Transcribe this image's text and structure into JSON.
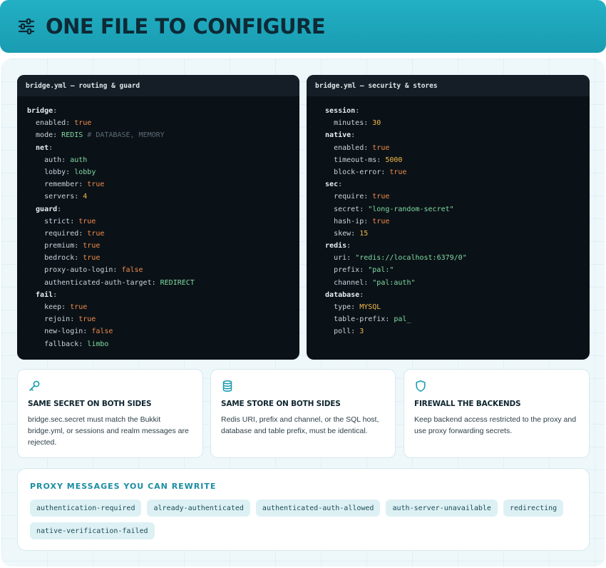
{
  "header": {
    "title": "ONE FILE TO CONFIGURE"
  },
  "code_left": {
    "title": "bridge.yml — routing & guard",
    "lines": [
      [
        {
          "t": "bridge",
          "c": "kb"
        },
        {
          "t": ":",
          "c": "k"
        }
      ],
      [
        {
          "t": "  enabled: ",
          "c": "k"
        },
        {
          "t": "true",
          "c": "bool"
        }
      ],
      [
        {
          "t": "  mode: ",
          "c": "k"
        },
        {
          "t": "REDIS",
          "c": "str"
        },
        {
          "t": " # DATABASE, MEMORY",
          "c": "cm"
        }
      ],
      [
        {
          "t": "  net",
          "c": "kb"
        },
        {
          "t": ":",
          "c": "k"
        }
      ],
      [
        {
          "t": "    auth: ",
          "c": "k"
        },
        {
          "t": "auth",
          "c": "str"
        }
      ],
      [
        {
          "t": "    lobby: ",
          "c": "k"
        },
        {
          "t": "lobby",
          "c": "str"
        }
      ],
      [
        {
          "t": "    remember: ",
          "c": "k"
        },
        {
          "t": "true",
          "c": "bool"
        }
      ],
      [
        {
          "t": "    servers: ",
          "c": "k"
        },
        {
          "t": "4",
          "c": "num"
        }
      ],
      [
        {
          "t": "  guard",
          "c": "kb"
        },
        {
          "t": ":",
          "c": "k"
        }
      ],
      [
        {
          "t": "    strict: ",
          "c": "k"
        },
        {
          "t": "true",
          "c": "bool"
        }
      ],
      [
        {
          "t": "    required: ",
          "c": "k"
        },
        {
          "t": "true",
          "c": "bool"
        }
      ],
      [
        {
          "t": "    premium: ",
          "c": "k"
        },
        {
          "t": "true",
          "c": "bool"
        }
      ],
      [
        {
          "t": "    bedrock: ",
          "c": "k"
        },
        {
          "t": "true",
          "c": "bool"
        }
      ],
      [
        {
          "t": "    proxy-auto-login: ",
          "c": "k"
        },
        {
          "t": "false",
          "c": "bool"
        }
      ],
      [
        {
          "t": "    authenticated-auth-target: ",
          "c": "k"
        },
        {
          "t": "REDIRECT",
          "c": "str"
        }
      ],
      [
        {
          "t": "  fail",
          "c": "kb"
        },
        {
          "t": ":",
          "c": "k"
        }
      ],
      [
        {
          "t": "    keep: ",
          "c": "k"
        },
        {
          "t": "true",
          "c": "bool"
        }
      ],
      [
        {
          "t": "    rejoin: ",
          "c": "k"
        },
        {
          "t": "true",
          "c": "bool"
        }
      ],
      [
        {
          "t": "    new-login: ",
          "c": "k"
        },
        {
          "t": "false",
          "c": "bool"
        }
      ],
      [
        {
          "t": "    fallback: ",
          "c": "k"
        },
        {
          "t": "limbo",
          "c": "str"
        }
      ]
    ]
  },
  "code_right": {
    "title": "bridge.yml — security & stores",
    "lines": [
      [
        {
          "t": "  session",
          "c": "kb"
        },
        {
          "t": ":",
          "c": "k"
        }
      ],
      [
        {
          "t": "    minutes: ",
          "c": "k"
        },
        {
          "t": "30",
          "c": "num"
        }
      ],
      [
        {
          "t": "  native",
          "c": "kb"
        },
        {
          "t": ":",
          "c": "k"
        }
      ],
      [
        {
          "t": "    enabled: ",
          "c": "k"
        },
        {
          "t": "true",
          "c": "bool"
        }
      ],
      [
        {
          "t": "    timeout-ms: ",
          "c": "k"
        },
        {
          "t": "5000",
          "c": "num"
        }
      ],
      [
        {
          "t": "    block-error: ",
          "c": "k"
        },
        {
          "t": "true",
          "c": "bool"
        }
      ],
      [
        {
          "t": "  sec",
          "c": "kb"
        },
        {
          "t": ":",
          "c": "k"
        }
      ],
      [
        {
          "t": "    require: ",
          "c": "k"
        },
        {
          "t": "true",
          "c": "bool"
        }
      ],
      [
        {
          "t": "    secret: ",
          "c": "k"
        },
        {
          "t": "\"long-random-secret\"",
          "c": "str"
        }
      ],
      [
        {
          "t": "    hash-ip: ",
          "c": "k"
        },
        {
          "t": "true",
          "c": "bool"
        }
      ],
      [
        {
          "t": "    skew: ",
          "c": "k"
        },
        {
          "t": "15",
          "c": "num"
        }
      ],
      [
        {
          "t": "  redis",
          "c": "kb"
        },
        {
          "t": ":",
          "c": "k"
        }
      ],
      [
        {
          "t": "    uri: ",
          "c": "k"
        },
        {
          "t": "\"redis://localhost:6379/0\"",
          "c": "str"
        }
      ],
      [
        {
          "t": "    prefix: ",
          "c": "k"
        },
        {
          "t": "\"pal:\"",
          "c": "str"
        }
      ],
      [
        {
          "t": "    channel: ",
          "c": "k"
        },
        {
          "t": "\"pal:auth\"",
          "c": "str"
        }
      ],
      [
        {
          "t": "  database",
          "c": "kb"
        },
        {
          "t": ":",
          "c": "k"
        }
      ],
      [
        {
          "t": "    type: ",
          "c": "k"
        },
        {
          "t": "MYSQL",
          "c": "num"
        }
      ],
      [
        {
          "t": "    table-prefix: ",
          "c": "k"
        },
        {
          "t": "pal_",
          "c": "str"
        }
      ],
      [
        {
          "t": "    poll: ",
          "c": "k"
        },
        {
          "t": "3",
          "c": "num"
        }
      ]
    ]
  },
  "cards": [
    {
      "icon": "key-icon",
      "title": "SAME SECRET ON BOTH SIDES",
      "desc": "bridge.sec.secret must match the Bukkit bridge.yml, or sessions and realm messages are rejected."
    },
    {
      "icon": "database-icon",
      "title": "SAME STORE ON BOTH SIDES",
      "desc": "Redis URI, prefix and channel, or the SQL host, database and table prefix, must be identical."
    },
    {
      "icon": "shield-icon",
      "title": "FIREWALL THE BACKENDS",
      "desc": "Keep backend access restricted to the proxy and use proxy forwarding secrets."
    }
  ],
  "messages": {
    "title": "PROXY MESSAGES YOU CAN REWRITE",
    "items": [
      "authentication-required",
      "already-authenticated",
      "authenticated-auth-allowed",
      "auth-server-unavailable",
      "redirecting",
      "native-verification-failed"
    ]
  },
  "colors": {
    "accent": "#1a9cb2",
    "code_bg": "#0b1217",
    "bool": "#f08a4b",
    "num": "#f2b84b",
    "str": "#7fd9a2"
  }
}
